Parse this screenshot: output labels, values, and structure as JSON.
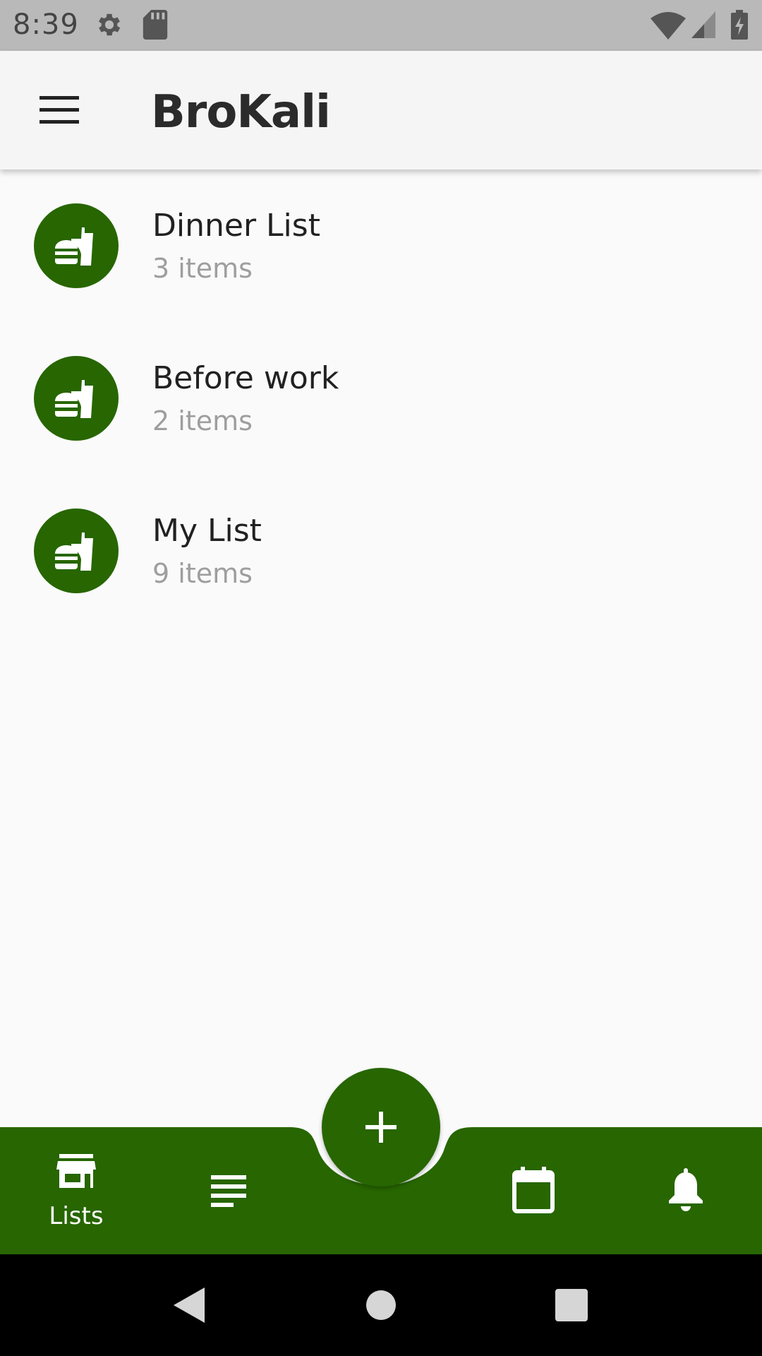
{
  "status_bar": {
    "time": "8:39",
    "icons": [
      "gear-icon",
      "sd-card-icon",
      "wifi-icon",
      "cell-signal-icon",
      "battery-charging-icon"
    ]
  },
  "app_bar": {
    "title": "BroKali",
    "menu_icon": "hamburger-menu-icon"
  },
  "lists": [
    {
      "name": "Dinner List",
      "count": "3 items",
      "icon": "fastfood-icon"
    },
    {
      "name": "Before work",
      "count": "2 items",
      "icon": "fastfood-icon"
    },
    {
      "name": "My List",
      "count": "9 items",
      "icon": "fastfood-icon"
    }
  ],
  "fab": {
    "icon": "plus-icon"
  },
  "bottom_nav": {
    "items": [
      {
        "label": "Lists",
        "icon": "store-icon",
        "active": true
      },
      {
        "label": "",
        "icon": "notes-icon",
        "active": false
      },
      {
        "label": "",
        "icon": "calendar-icon",
        "active": false
      },
      {
        "label": "",
        "icon": "bell-icon",
        "active": false
      }
    ]
  },
  "system_nav": {
    "icons": [
      "back-icon",
      "home-icon",
      "recents-icon"
    ]
  },
  "colors": {
    "accent": "#276600",
    "background": "#fafafa",
    "status_bar": "#b9b9b9"
  }
}
